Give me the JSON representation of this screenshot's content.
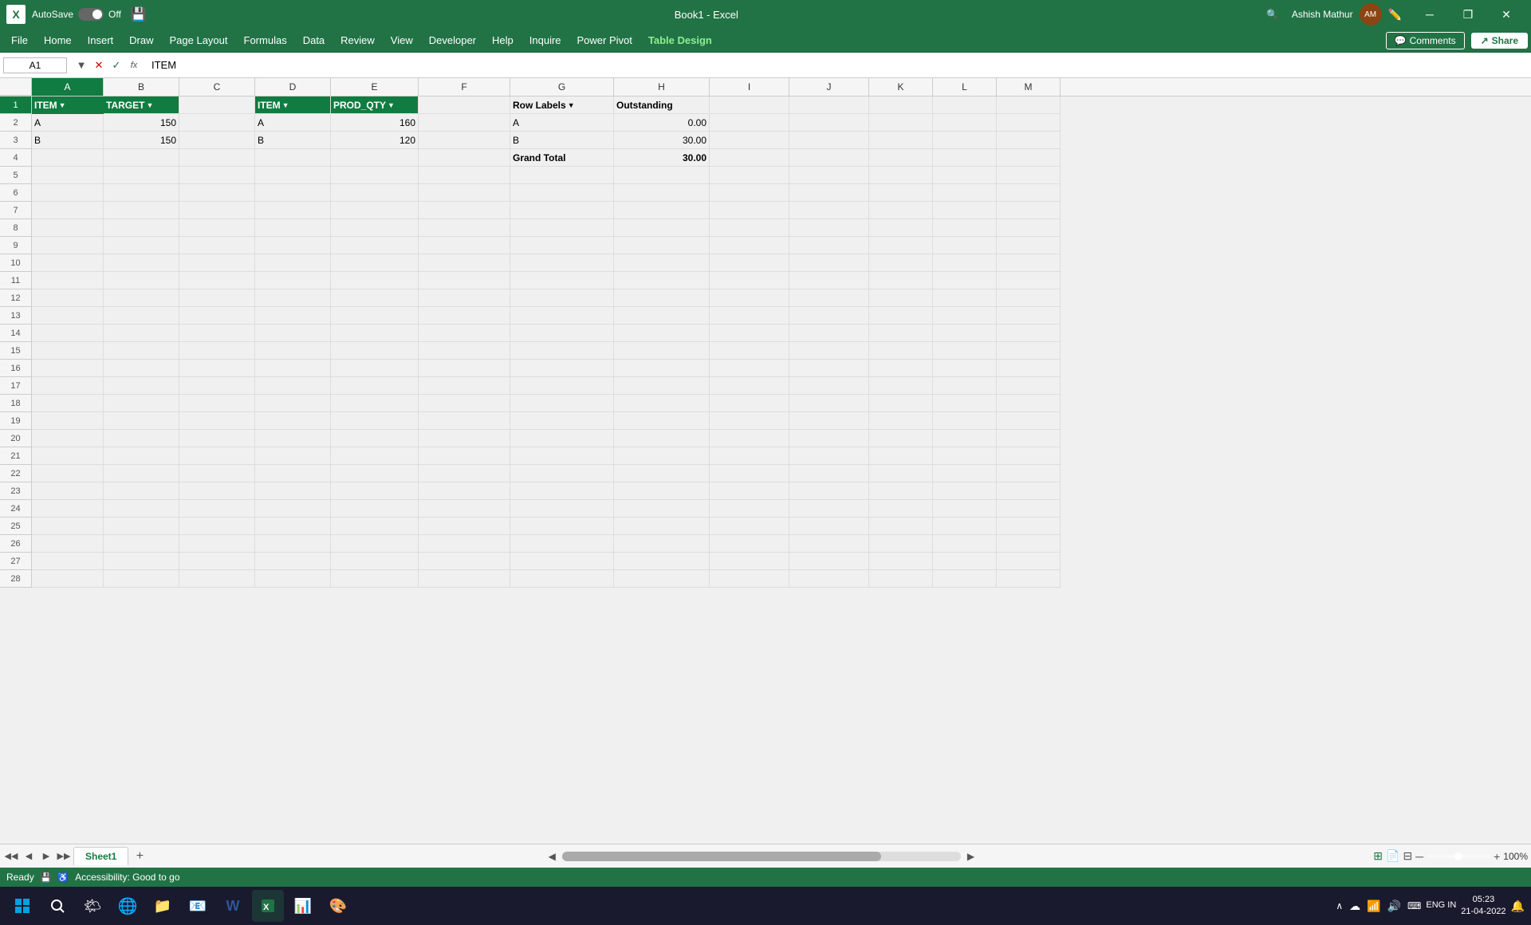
{
  "titleBar": {
    "appName": "Book1 - Excel",
    "autosave": "AutoSave",
    "autosaveState": "Off",
    "user": "Ashish Mathur",
    "windowTitle": "Book1  -  Excel"
  },
  "menuBar": {
    "items": [
      "File",
      "Home",
      "Insert",
      "Draw",
      "Page Layout",
      "Formulas",
      "Data",
      "Review",
      "View",
      "Developer",
      "Help",
      "Inquire",
      "Power Pivot",
      "Table Design"
    ],
    "activeItem": "Table Design",
    "comments": "Comments",
    "share": "Share"
  },
  "formulaBar": {
    "cellRef": "A1",
    "formula": "ITEM"
  },
  "columns": {
    "headers": [
      "A",
      "B",
      "C",
      "D",
      "E",
      "F",
      "G",
      "H",
      "I",
      "J",
      "K",
      "L",
      "M"
    ],
    "selectedCol": "A"
  },
  "rows": {
    "count": 28
  },
  "tableData": {
    "headers": [
      {
        "col": "A",
        "value": "ITEM",
        "hasFilter": true
      },
      {
        "col": "B",
        "value": "TARGET",
        "hasFilter": true
      },
      {
        "col": "D",
        "value": "ITEM",
        "hasFilter": true
      },
      {
        "col": "E",
        "value": "PROD_QTY",
        "hasFilter": true
      }
    ],
    "data": [
      {
        "row": 2,
        "A": "A",
        "B": "150",
        "D": "A",
        "E": "160"
      },
      {
        "row": 3,
        "A": "B",
        "B": "150",
        "D": "B",
        "E": "120"
      }
    ]
  },
  "pivotTable": {
    "header1": "Row Labels",
    "header2": "Outstanding",
    "rows": [
      {
        "label": "A",
        "value": "0.00"
      },
      {
        "label": "B",
        "value": "30.00"
      },
      {
        "label": "Grand Total",
        "value": "30.00"
      }
    ]
  },
  "sheets": {
    "tabs": [
      "Sheet1"
    ],
    "active": "Sheet1",
    "addLabel": "+"
  },
  "statusBar": {
    "status": "Ready",
    "accessibility": "Accessibility: Good to go",
    "zoom": "100%"
  },
  "taskbar": {
    "time": "05:23",
    "date": "21-04-2022",
    "language": "ENG IN"
  }
}
